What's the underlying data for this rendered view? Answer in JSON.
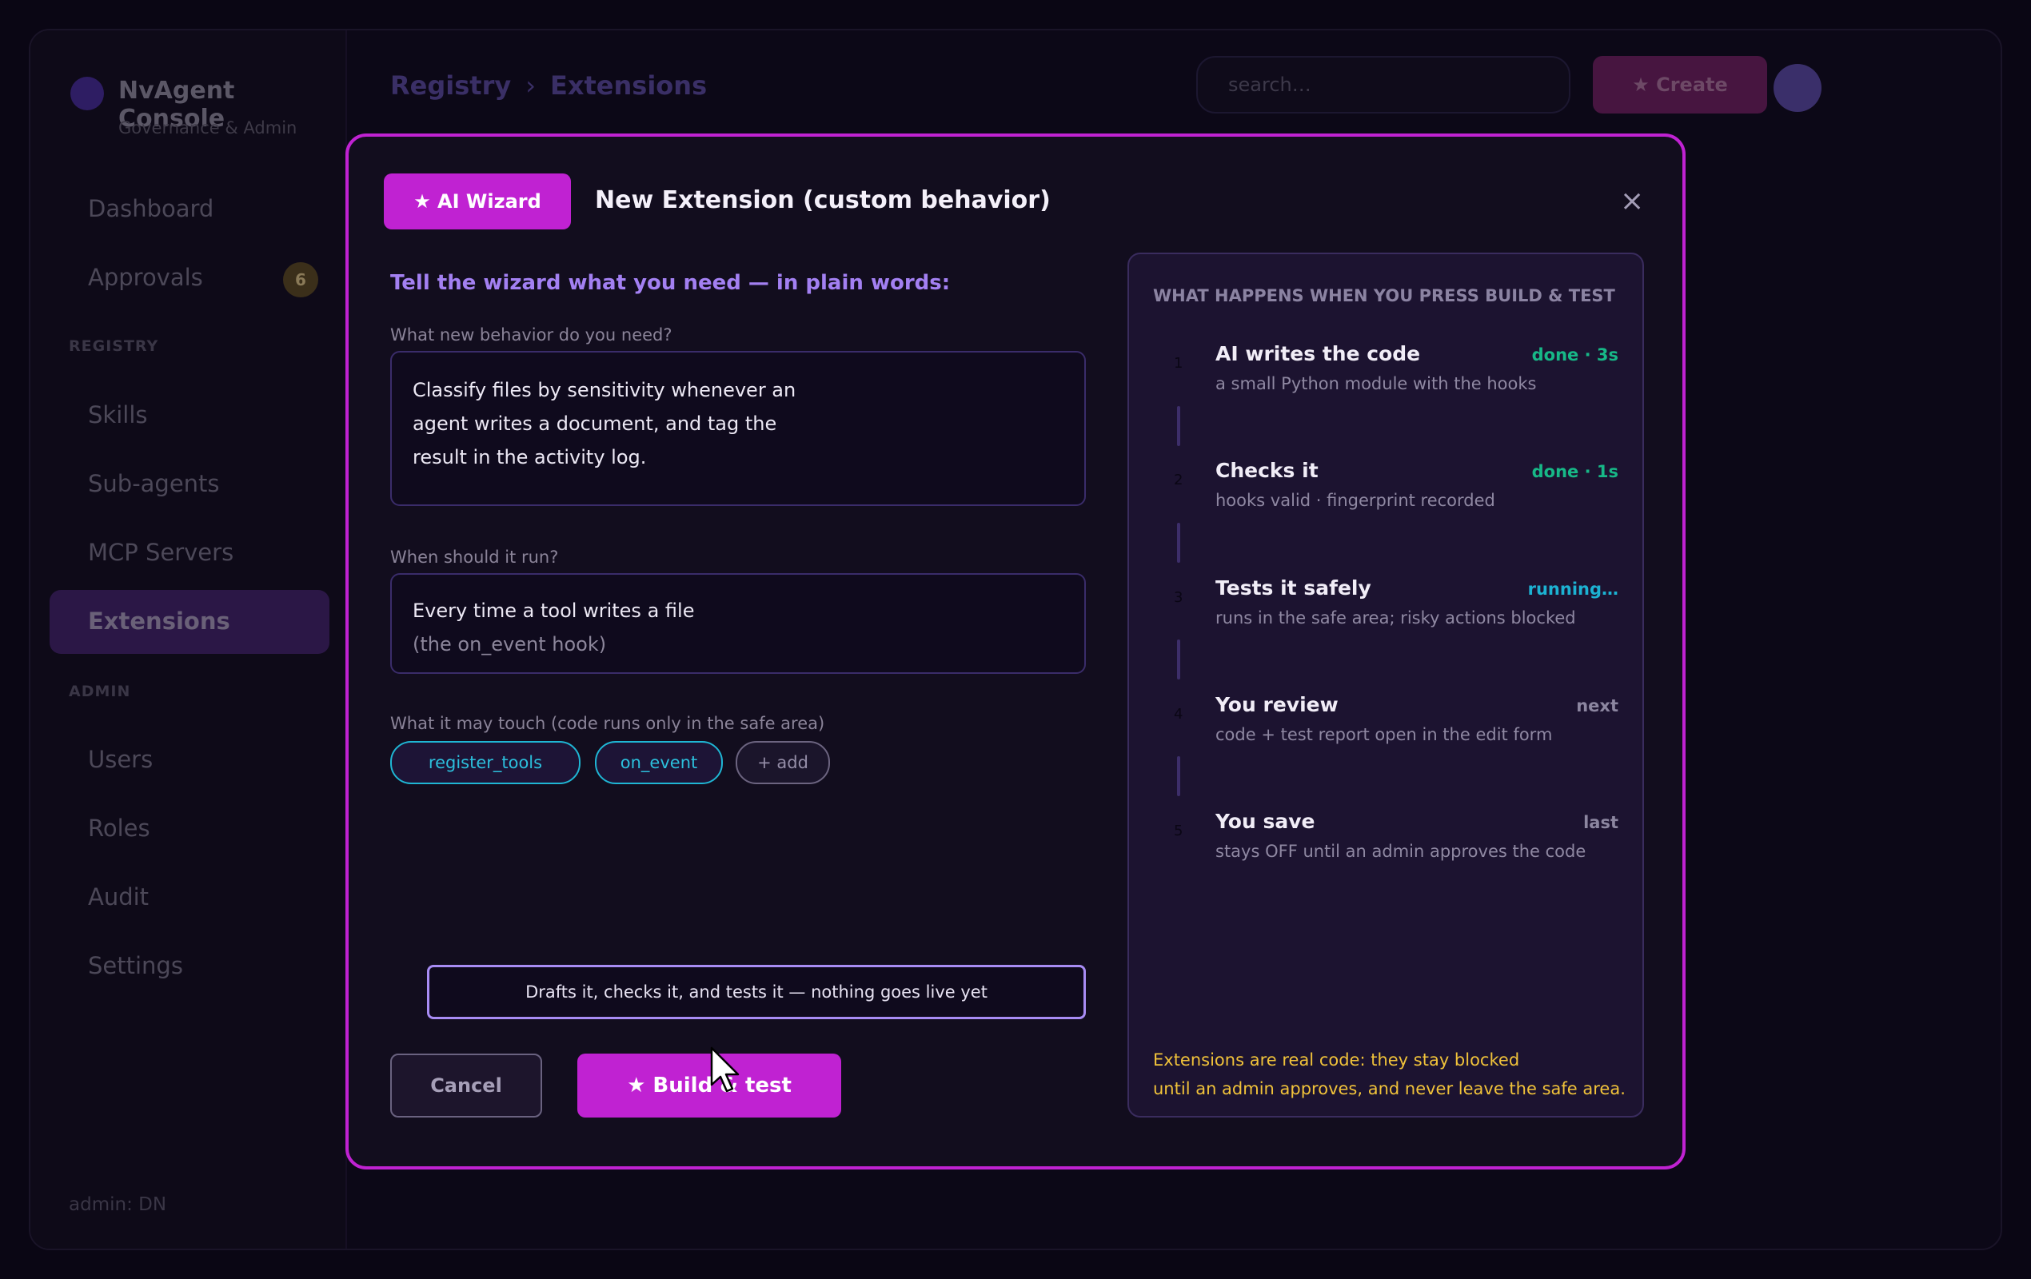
{
  "app": {
    "name": "NvAgent Console",
    "subtitle": "Governance & Admin"
  },
  "sidebar": {
    "items": [
      {
        "label": "Dashboard"
      },
      {
        "label": "Approvals",
        "badge": "6"
      }
    ],
    "registry_heading": "REGISTRY",
    "registry_items": [
      {
        "label": "Skills"
      },
      {
        "label": "Sub-agents"
      },
      {
        "label": "MCP Servers"
      },
      {
        "label": "Extensions",
        "active": true
      }
    ],
    "admin_heading": "ADMIN",
    "admin_items": [
      {
        "label": "Users"
      },
      {
        "label": "Roles"
      },
      {
        "label": "Audit"
      },
      {
        "label": "Settings"
      }
    ],
    "footer_user": "admin: DN"
  },
  "header": {
    "breadcrumb": [
      "Registry",
      "Extensions"
    ],
    "breadcrumb_sep": "›",
    "search_placeholder": "search…",
    "create_label": "★ Create"
  },
  "modal": {
    "wizard_label": "★ AI Wizard",
    "title": "New Extension (custom behavior)",
    "close_glyph": "×",
    "lead": "Tell the wizard what you need — in plain words:",
    "behavior_label": "What new behavior do you need?",
    "behavior_lines": [
      "Classify files by sensitivity whenever an",
      "agent writes a document, and tag the",
      "result in the activity log."
    ],
    "when_label": "When should it run?",
    "when_value": "Every time a tool writes a file",
    "when_hint": "(the on_event hook)",
    "touch_label": "What it may touch  (code runs only in the safe area)",
    "chips": [
      "register_tools",
      "on_event"
    ],
    "add_chip": "+ add",
    "info": "Drafts it, checks it, and tests it — nothing goes live yet",
    "cancel_label": "Cancel",
    "build_label": "★ Build & test"
  },
  "panel": {
    "heading": "WHAT HAPPENS WHEN YOU PRESS BUILD & TEST",
    "steps": [
      {
        "num": "1",
        "title": "AI writes the code",
        "desc": "a small Python module with the hooks",
        "status": "done · 3s"
      },
      {
        "num": "2",
        "title": "Checks it",
        "desc": "hooks valid · fingerprint recorded",
        "status": "done · 1s"
      },
      {
        "num": "3",
        "title": "Tests it safely",
        "desc": "runs in the safe area; risky actions blocked",
        "status": "running…"
      },
      {
        "num": "4",
        "title": "You review",
        "desc": "code + test report open in the edit form",
        "status": "next"
      },
      {
        "num": "5",
        "title": "You save",
        "desc": "stays OFF until an admin approves the code",
        "status": "last"
      }
    ],
    "note_lines": [
      "Extensions are real code: they stay blocked",
      "until an admin approves, and never leave the safe area."
    ]
  },
  "colors": {
    "accent": "#c022d2",
    "purple_text": "#a380f2",
    "done": "#17b887",
    "running": "#1cb2d2",
    "warning": "#f0c23a"
  }
}
